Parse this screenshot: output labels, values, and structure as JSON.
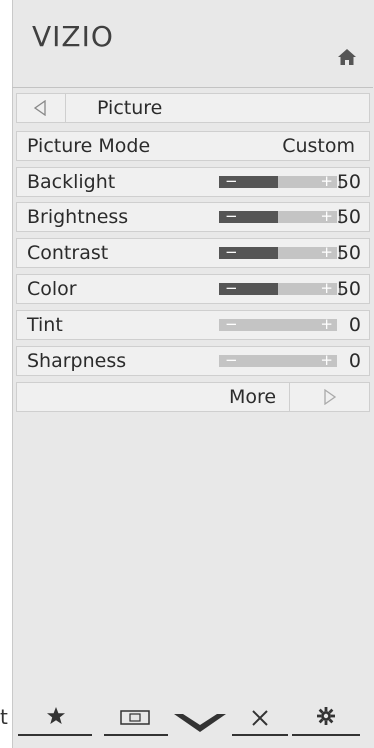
{
  "brand": {
    "logo_text": "VIZIO"
  },
  "menu": {
    "title": "Picture",
    "rows": [
      {
        "label": "Picture Mode",
        "value": "Custom"
      },
      {
        "label": "Backlight",
        "value": "50",
        "level": 0.5
      },
      {
        "label": "Brightness",
        "value": "50",
        "level": 0.5
      },
      {
        "label": "Contrast",
        "value": "50",
        "level": 0.5
      },
      {
        "label": "Color",
        "value": "50",
        "level": 0.5
      },
      {
        "label": "Tint",
        "value": "0",
        "level": 0.0
      },
      {
        "label": "Sharpness",
        "value": "0",
        "level": 0.0
      }
    ],
    "more_label": "More"
  },
  "slider_signs": {
    "minus": "−",
    "plus": "+"
  },
  "bottom_bar": {
    "leading_text": "t",
    "icons": [
      "star-icon",
      "input-icon",
      "vizio-v-icon",
      "close-icon",
      "settings-gear-icon"
    ]
  },
  "colors": {
    "panel_bg": "#e8e8e8",
    "row_bg": "#f0f0f0",
    "slider_fill": "#555555",
    "slider_track": "#c4c4c4"
  }
}
